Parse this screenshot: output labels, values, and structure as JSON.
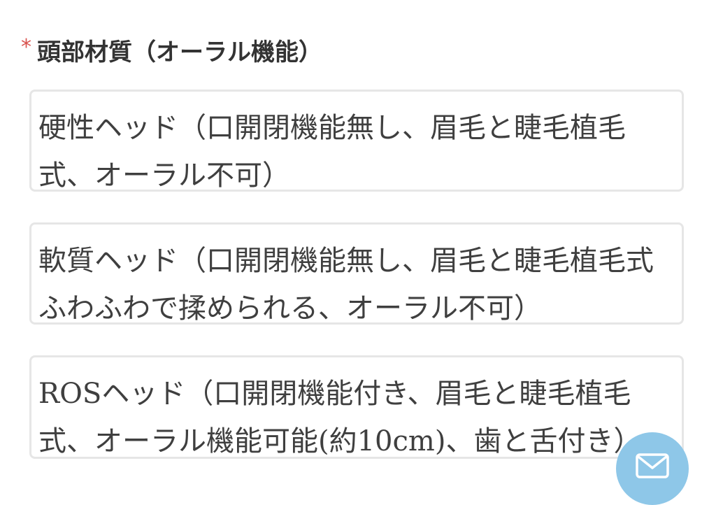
{
  "field": {
    "required_mark": "*",
    "label": "頭部材質（オーラル機能）"
  },
  "options": [
    {
      "label": "硬性ヘッド（口開閉機能無し、眉毛と睫毛植毛式、オーラル不可）"
    },
    {
      "label": "軟質ヘッド（口開閉機能無し、眉毛と睫毛植毛式ふわふわで揉められる、オーラル不可）"
    },
    {
      "label": "ROSヘッド（口開閉機能付き、眉毛と睫毛植毛式、オーラル機能可能(約10cm)、歯と舌付き）"
    }
  ],
  "fab": {
    "icon": "mail-icon",
    "color": "#8ec7e8"
  }
}
